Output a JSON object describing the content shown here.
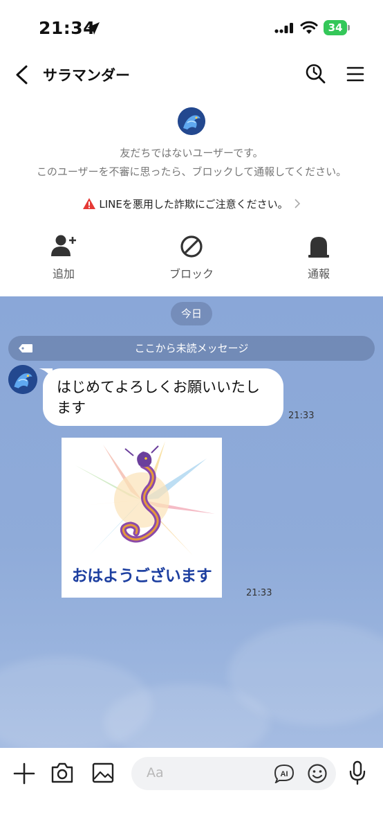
{
  "status_bar": {
    "time": "21:34",
    "battery": "34",
    "battery_color": "#34c759"
  },
  "header": {
    "title": "サラマンダー",
    "icons": [
      "back-chevron-icon",
      "search-clock-icon",
      "hamburger-menu-icon"
    ]
  },
  "notice": {
    "line1": "友だちではないユーザーです。",
    "line2": "このユーザーを不審に思ったら、ブロックして通報してください。",
    "warning": "LINEを悪用した詐欺にご注意ください。",
    "warning_color": "#e53935",
    "actions": [
      {
        "label": "追加",
        "icon": "add-friend-icon"
      },
      {
        "label": "ブロック",
        "icon": "block-icon"
      },
      {
        "label": "通報",
        "icon": "report-icon"
      }
    ]
  },
  "chat": {
    "date_label": "今日",
    "unread_label": "ここから未読メッセージ",
    "background_color": "#8fabd9",
    "messages": [
      {
        "type": "text",
        "text": "はじめてよろしくお願いいたします",
        "time": "21:33"
      },
      {
        "type": "sticker",
        "text": "おはようございます",
        "time": "21:33"
      }
    ]
  },
  "input_bar": {
    "placeholder": "Aa",
    "icons": [
      "plus-icon",
      "camera-icon",
      "image-icon",
      "ai-icon",
      "emoji-icon",
      "microphone-icon"
    ]
  }
}
